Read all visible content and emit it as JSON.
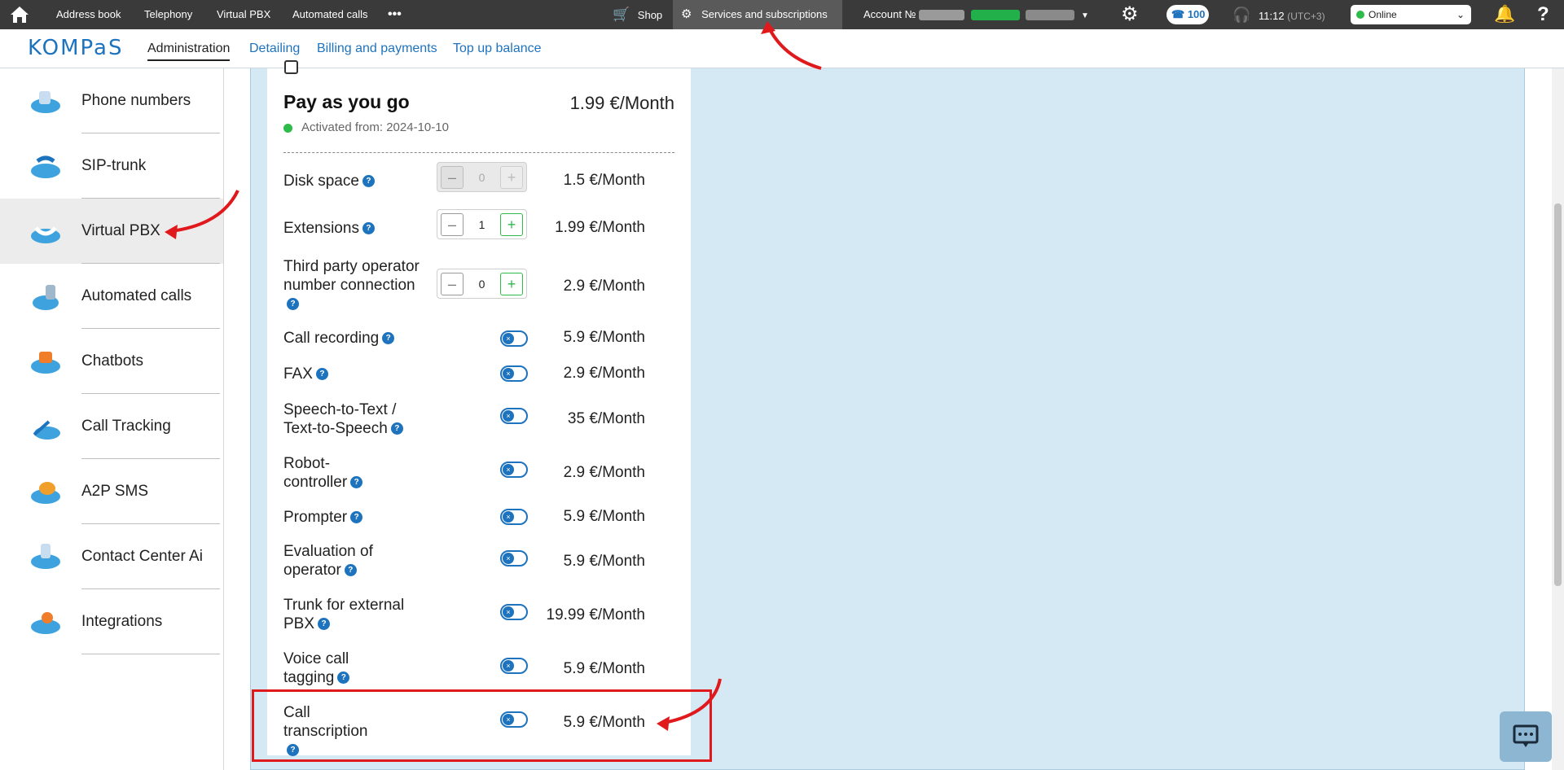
{
  "topbar": {
    "nav_items": [
      "Address book",
      "Telephony",
      "Virtual PBX",
      "Automated calls"
    ],
    "more": "•••",
    "shop": "Shop",
    "services": "Services and subscriptions",
    "account_label": "Account №",
    "calls_count": "100",
    "time": "11:12",
    "timezone": "(UTC+3)",
    "status": "Online"
  },
  "subnav": {
    "logo": "KOMPaS",
    "items": [
      "Administration",
      "Detailing",
      "Billing and payments",
      "Top up balance"
    ],
    "active": "Administration"
  },
  "sidebar": {
    "items": [
      {
        "label": "Phone numbers",
        "icon": "phone-numbers-icon"
      },
      {
        "label": "SIP-trunk",
        "icon": "sip-trunk-icon"
      },
      {
        "label": "Virtual PBX",
        "icon": "virtual-pbx-icon",
        "active": true
      },
      {
        "label": "Automated calls",
        "icon": "automated-calls-icon"
      },
      {
        "label": "Chatbots",
        "icon": "chatbots-icon"
      },
      {
        "label": "Call Tracking",
        "icon": "call-tracking-icon"
      },
      {
        "label": "A2P SMS",
        "icon": "a2p-sms-icon"
      },
      {
        "label": "Contact Center Ai",
        "icon": "contact-center-icon"
      },
      {
        "label": "Integrations",
        "icon": "integrations-icon"
      }
    ]
  },
  "plan": {
    "title": "Pay as you go",
    "price": "1.99 €/Month",
    "activated": "Activated from: 2024-10-10"
  },
  "options": [
    {
      "name": "Disk space",
      "price": "1.5 €/Month",
      "control": "stepper",
      "value": "0",
      "disabled": true
    },
    {
      "name": "Extensions",
      "price": "1.99 €/Month",
      "control": "stepper",
      "value": "1"
    },
    {
      "name": "Third party operator number connection",
      "price": "2.9 €/Month",
      "control": "stepper",
      "value": "0"
    },
    {
      "name": "Call recording",
      "price": "5.9 €/Month",
      "control": "toggle",
      "on": false
    },
    {
      "name": "FAX",
      "price": "2.9 €/Month",
      "control": "toggle",
      "on": false
    },
    {
      "name": "Speech-to-Text / Text-to-Speech",
      "price": "35 €/Month",
      "control": "toggle",
      "on": false
    },
    {
      "name": "Robot-controller",
      "price": "2.9 €/Month",
      "control": "toggle",
      "on": false
    },
    {
      "name": "Prompter",
      "price": "5.9 €/Month",
      "control": "toggle",
      "on": false
    },
    {
      "name": "Evaluation of operator",
      "price": "5.9 €/Month",
      "control": "toggle",
      "on": false
    },
    {
      "name": "Trunk for external PBX",
      "price": "19.99 €/Month",
      "control": "toggle",
      "on": false
    },
    {
      "name": "Voice call tagging",
      "price": "5.9 €/Month",
      "control": "toggle",
      "on": false
    },
    {
      "name": "Call transcription",
      "price": "5.9 €/Month",
      "control": "toggle",
      "on": false
    }
  ],
  "colors": {
    "accent": "#1e73be",
    "topbar": "#3a3a3a",
    "main_bg": "#d5e9f5",
    "online": "#2dbb4a",
    "highlight": "#e0191c"
  }
}
